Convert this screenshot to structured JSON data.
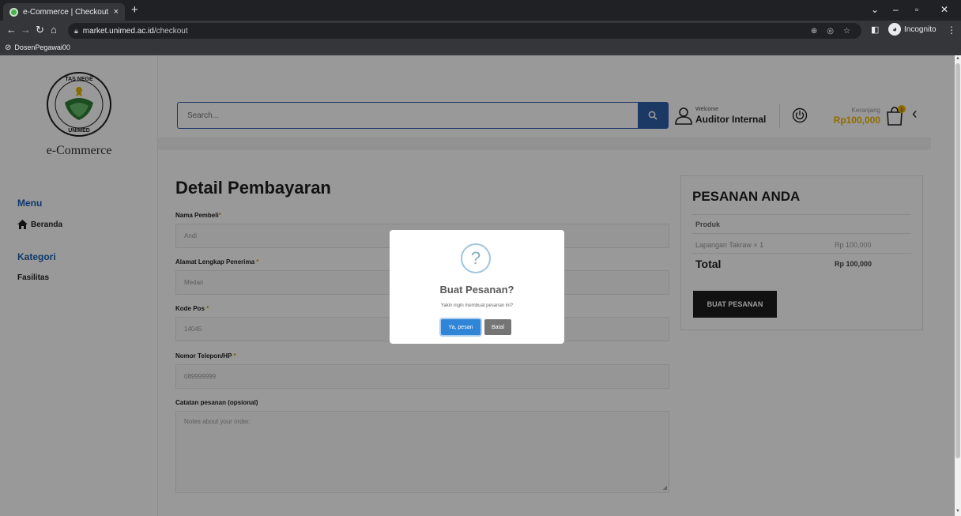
{
  "browser": {
    "tab_title": "e-Commerce | Checkout",
    "tab_close": "×",
    "new_tab": "+",
    "url_host": "market.unimed.ac.id",
    "url_path": "/checkout",
    "incognito_label": "Incognito",
    "bookmark_label": "DosenPegawai00",
    "win_minimize": "–",
    "win_restore": "▫",
    "win_close": "✕",
    "tab_search": "⌄"
  },
  "sidebar": {
    "brand": "e-Commerce",
    "menu_heading": "Menu",
    "menu_items": [
      {
        "label": "Beranda"
      }
    ],
    "category_heading": "Kategori",
    "category_items": [
      {
        "label": "Fasilitas"
      }
    ]
  },
  "header": {
    "search_placeholder": "Search...",
    "welcome": "Welcome",
    "username": "Auditor Internal",
    "cart_label": "Keranjang",
    "cart_total": "Rp100,000",
    "cart_count": "1"
  },
  "form": {
    "title": "Detail Pembayaran",
    "fields": [
      {
        "label": "Nama Pembeli",
        "value": "Andi"
      },
      {
        "label": "Alamat Lengkap Penerima",
        "value": "Medan"
      },
      {
        "label": "Kode Pos",
        "value": "14045"
      },
      {
        "label": "Nomor Telepon/HP",
        "value": "089999999"
      }
    ],
    "required_mark": "*",
    "notes_label": "Catatan pesanan (opsional)",
    "notes_placeholder": "Notes about your order."
  },
  "order": {
    "title": "PESANAN ANDA",
    "product_header": "Produk",
    "items": [
      {
        "name": "Lapangan Takraw × 1",
        "price": "Rp 100,000"
      }
    ],
    "total_label": "Total",
    "total_value": "Rp 100,000",
    "button_label": "BUAT PESANAN"
  },
  "modal": {
    "icon_glyph": "?",
    "title": "Buat Pesanan?",
    "text": "Yakin ingin membuat pesanan ini?",
    "confirm_label": "Ya, pesan",
    "cancel_label": "Batal"
  },
  "colors": {
    "accent_blue": "#2f5ea8",
    "cart_yellow": "#f0b400",
    "confirm_blue": "#3085d6"
  }
}
